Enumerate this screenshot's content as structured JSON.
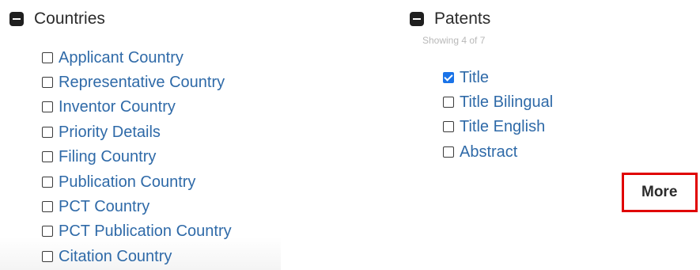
{
  "countries": {
    "title": "Countries",
    "options": [
      {
        "label": "Applicant Country",
        "checked": false
      },
      {
        "label": "Representative Country",
        "checked": false
      },
      {
        "label": "Inventor Country",
        "checked": false
      },
      {
        "label": "Priority Details",
        "checked": false
      },
      {
        "label": "Filing Country",
        "checked": false
      },
      {
        "label": "Publication Country",
        "checked": false
      },
      {
        "label": "PCT Country",
        "checked": false
      },
      {
        "label": "PCT Publication Country",
        "checked": false
      },
      {
        "label": "Citation Country",
        "checked": false
      }
    ]
  },
  "patents": {
    "title": "Patents",
    "showing": "Showing 4 of 7",
    "options": [
      {
        "label": "Title",
        "checked": true
      },
      {
        "label": "Title Bilingual",
        "checked": false
      },
      {
        "label": "Title English",
        "checked": false
      },
      {
        "label": "Abstract",
        "checked": false
      }
    ],
    "more_label": "More"
  },
  "colors": {
    "link": "#2f6aa8",
    "checked": "#1a73e8",
    "highlight": "#e00000"
  }
}
